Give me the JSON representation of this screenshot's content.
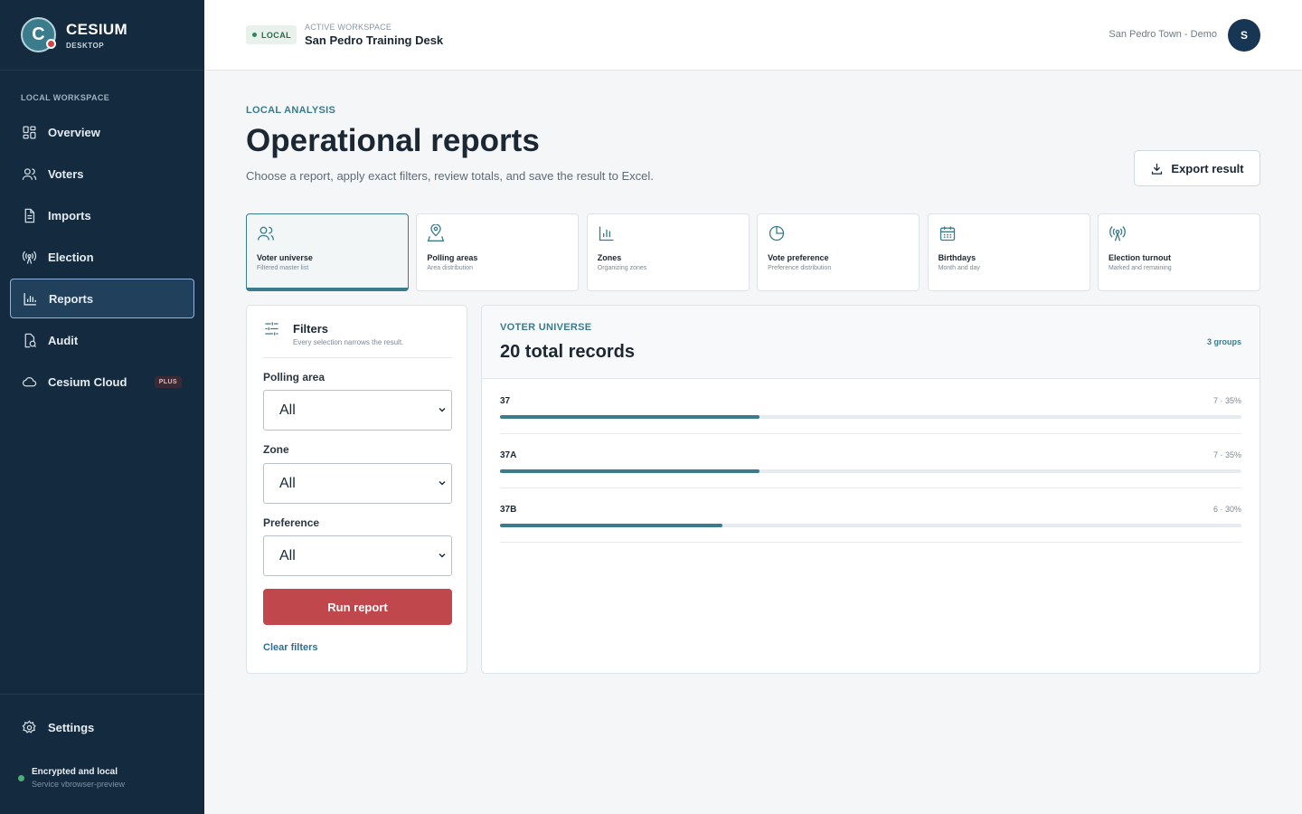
{
  "brand": {
    "initial": "C",
    "name": "CESIUM",
    "sub": "DESKTOP"
  },
  "sidebar": {
    "section_label": "LOCAL WORKSPACE",
    "items": [
      {
        "label": "Overview",
        "icon": "grid-icon"
      },
      {
        "label": "Voters",
        "icon": "users-icon"
      },
      {
        "label": "Imports",
        "icon": "document-icon"
      },
      {
        "label": "Election",
        "icon": "broadcast-icon"
      },
      {
        "label": "Reports",
        "icon": "bar-chart-icon",
        "active": true
      },
      {
        "label": "Audit",
        "icon": "audit-icon"
      },
      {
        "label": "Cesium Cloud",
        "icon": "cloud-icon",
        "badge": "PLUS"
      }
    ],
    "settings_label": "Settings",
    "status_title": "Encrypted and local",
    "status_sub": "Service vbrowser-preview"
  },
  "header": {
    "badge": "LOCAL",
    "workspace_label": "ACTIVE WORKSPACE",
    "workspace_name": "San Pedro Training Desk",
    "user_name": "San Pedro Town - Demo",
    "avatar_initial": "S"
  },
  "page": {
    "eyebrow": "LOCAL ANALYSIS",
    "title": "Operational reports",
    "description": "Choose a report, apply exact filters, review totals, and save the result to Excel.",
    "export_label": "Export result"
  },
  "tiles": [
    {
      "title": "Voter universe",
      "sub": "Filtered master list",
      "icon": "users-icon",
      "active": true
    },
    {
      "title": "Polling areas",
      "sub": "Area distribution",
      "icon": "map-pin-icon"
    },
    {
      "title": "Zones",
      "sub": "Organizing zones",
      "icon": "bar-chart-icon"
    },
    {
      "title": "Vote preference",
      "sub": "Preference distribution",
      "icon": "pie-chart-icon"
    },
    {
      "title": "Birthdays",
      "sub": "Month and day",
      "icon": "calendar-icon"
    },
    {
      "title": "Election turnout",
      "sub": "Marked and remaining",
      "icon": "broadcast-icon"
    }
  ],
  "filters": {
    "title": "Filters",
    "subtitle": "Every selection narrows the result.",
    "polling_area_label": "Polling area",
    "polling_area_value": "All",
    "zone_label": "Zone",
    "zone_value": "All",
    "preference_label": "Preference",
    "preference_value": "All",
    "run_label": "Run report",
    "clear_label": "Clear filters"
  },
  "results": {
    "eyebrow": "VOTER UNIVERSE",
    "total": "20 total records",
    "groups": "3 groups",
    "rows": [
      {
        "label": "37",
        "meta": "7 · 35%",
        "fraction": 0.35
      },
      {
        "label": "37A",
        "meta": "7 · 35%",
        "fraction": 0.35
      },
      {
        "label": "37B",
        "meta": "6 · 30%",
        "fraction": 0.3
      }
    ]
  },
  "colors": {
    "accent": "#3b7c8c",
    "sidebar": "#142a3e",
    "danger": "#c0474b"
  }
}
